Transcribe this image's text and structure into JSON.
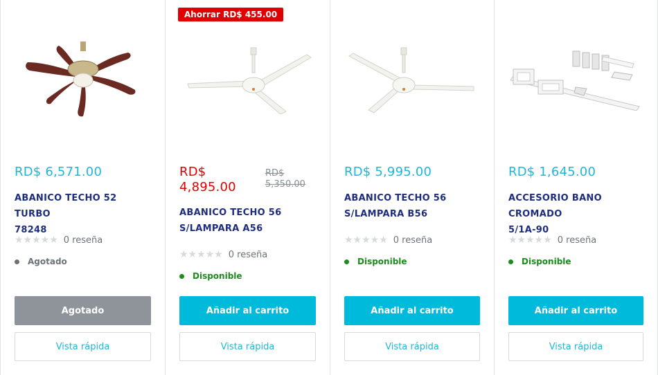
{
  "products": [
    {
      "price": "RD$ 6,571.00",
      "title_line1": "ABANICO TECHO 52 TURBO",
      "title_line2": "78248",
      "stars": "★★★★★",
      "reviews": "0 reseña",
      "stock": "Agotado",
      "button": "Agotado",
      "quick_view": "Vista rápida",
      "image_icon": "ceiling-fan-wood-blades"
    },
    {
      "badge": "Ahorrar RD$ 455.00",
      "price_line1": "RD$",
      "price_line2": "4,895.00",
      "compare_line1": "RD$",
      "compare_line2": "5,350.00",
      "title_line1": "ABANICO TECHO 56",
      "title_line2": "S/LAMPARA A56",
      "stars": "★★★★★",
      "reviews": "0 reseña",
      "stock": "Disponible",
      "button": "Añadir al carrito",
      "quick_view": "Vista rápida",
      "image_icon": "ceiling-fan-white"
    },
    {
      "price": "RD$ 5,995.00",
      "title_line1": "ABANICO TECHO 56",
      "title_line2": "S/LAMPARA B56",
      "stars": "★★★★★",
      "reviews": "0 reseña",
      "stock": "Disponible",
      "button": "Añadir al carrito",
      "quick_view": "Vista rápida",
      "image_icon": "ceiling-fan-white"
    },
    {
      "price": "RD$ 1,645.00",
      "title_line1": "ACCESORIO BANO CROMADO",
      "title_line2": "5/1A-90",
      "stars": "★★★★★",
      "reviews": "0 reseña",
      "stock": "Disponible",
      "button": "Añadir al carrito",
      "quick_view": "Vista rápida",
      "image_icon": "bathroom-accessory-set"
    }
  ],
  "colors": {
    "accent": "#00badb",
    "sale": "#e00000",
    "available": "#1c8c1c",
    "title": "#1e2d7d"
  }
}
